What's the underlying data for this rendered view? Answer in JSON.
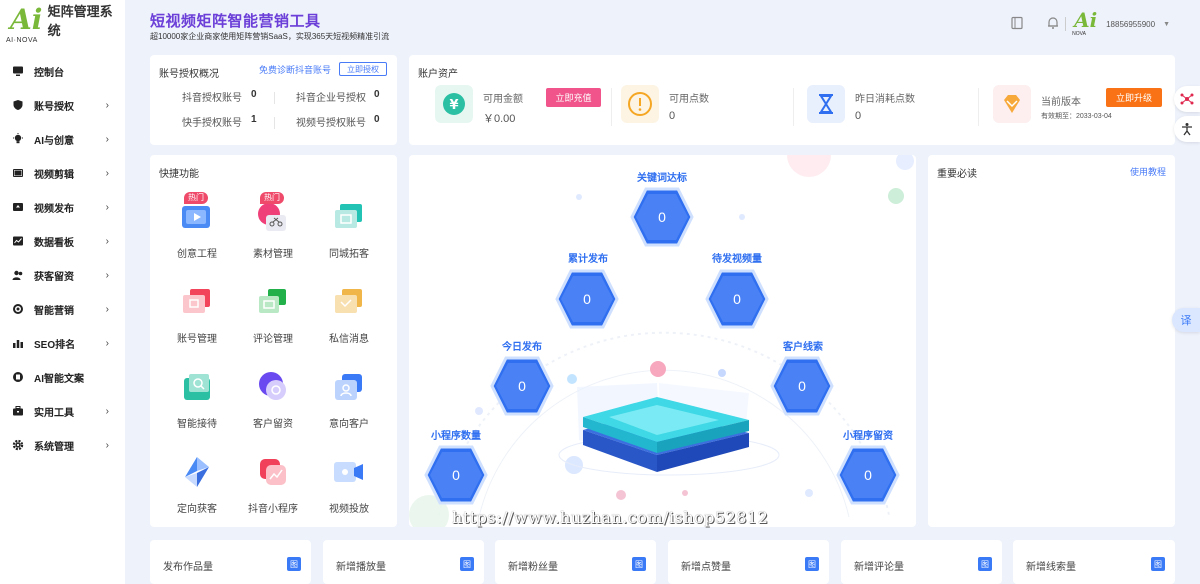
{
  "brand": {
    "logo_mark": "Ai",
    "logo_sub": "AI·NOVA",
    "title": "矩阵管理系统"
  },
  "sidebar": {
    "items": [
      {
        "label": "控制台",
        "icon": "monitor-icon",
        "chev": ""
      },
      {
        "label": "账号授权",
        "icon": "shield-icon",
        "chev": "›"
      },
      {
        "label": "AI与创意",
        "icon": "bulb-icon",
        "chev": "›"
      },
      {
        "label": "视频剪辑",
        "icon": "film-icon",
        "chev": "›"
      },
      {
        "label": "视频发布",
        "icon": "upload-icon",
        "chev": "›"
      },
      {
        "label": "数据看板",
        "icon": "chart-icon",
        "chev": "›"
      },
      {
        "label": "获客留资",
        "icon": "users-icon",
        "chev": "›"
      },
      {
        "label": "智能营销",
        "icon": "target-icon",
        "chev": "›"
      },
      {
        "label": "SEO排名",
        "icon": "bars-icon",
        "chev": "›"
      },
      {
        "label": "AI智能文案",
        "icon": "doc-icon",
        "chev": ""
      },
      {
        "label": "实用工具",
        "icon": "toolbox-icon",
        "chev": "›"
      },
      {
        "label": "系统管理",
        "icon": "gear-icon",
        "chev": "›"
      }
    ]
  },
  "header": {
    "title": "短视频矩阵智能营销工具",
    "subtitle": "超10000家企业商家使用矩阵营销SaaS，实现365天短视频精准引流",
    "phone": "18856955900",
    "caret": "▼",
    "avatar_mark": "Ai",
    "avatar_sub": "NOVA"
  },
  "accounts": {
    "title": "账号授权概况",
    "diag_link": "免费诊断抖音账号",
    "auth_button": "立即授权",
    "rows": [
      {
        "k1": "抖音授权账号",
        "v1": "0",
        "k2": "抖音企业号授权",
        "v2": "0"
      },
      {
        "k1": "快手授权账号",
        "v1": "1",
        "k2": "视频号授权账号",
        "v2": "0"
      }
    ]
  },
  "assets": {
    "title": "账户资产",
    "balance_label": "可用金额",
    "balance_value": "￥0.00",
    "recharge_button": "立即充值",
    "points_label": "可用点数",
    "points_value": "0",
    "consumed_label": "昨日消耗点数",
    "consumed_value": "0",
    "version_label": "当前版本",
    "version_expiry": "有效期至：2033-03-04",
    "upgrade_button": "立即升级",
    "colors": {
      "yen": "#2bbfa4",
      "warn": "#f5a623",
      "hourglass": "#2f6ff0",
      "upgrade": "#f97316",
      "recharge": "#f0548a"
    }
  },
  "quick": {
    "title": "快捷功能",
    "hot_badge": "热门",
    "items": [
      {
        "label": "创意工程",
        "icon": "video-icon",
        "hot": true
      },
      {
        "label": "素材管理",
        "icon": "scissors-icon",
        "hot": true
      },
      {
        "label": "同城拓客",
        "icon": "screen-icon",
        "hot": false
      },
      {
        "label": "账号管理",
        "icon": "account-card-icon",
        "hot": false
      },
      {
        "label": "评论管理",
        "icon": "comment-icon",
        "hot": false
      },
      {
        "label": "私信消息",
        "icon": "message-icon",
        "hot": false
      },
      {
        "label": "智能接待",
        "icon": "reception-icon",
        "hot": false
      },
      {
        "label": "客户留资",
        "icon": "lead-icon",
        "hot": false
      },
      {
        "label": "意向客户",
        "icon": "intent-icon",
        "hot": false
      },
      {
        "label": "定向获客",
        "icon": "target-acquire-icon",
        "hot": false
      },
      {
        "label": "抖音小程序",
        "icon": "miniapp-icon",
        "hot": false
      },
      {
        "label": "视频投放",
        "icon": "camera-icon",
        "hot": false
      }
    ]
  },
  "metrics": [
    {
      "label": "关键词达标",
      "value": "0"
    },
    {
      "label": "累计发布",
      "value": "0"
    },
    {
      "label": "待发视频量",
      "value": "0"
    },
    {
      "label": "今日发布",
      "value": "0"
    },
    {
      "label": "客户线索",
      "value": "0"
    },
    {
      "label": "小程序数量",
      "value": "0"
    },
    {
      "label": "小程序留资",
      "value": "0"
    }
  ],
  "notice": {
    "title": "重要必读",
    "link": "使用教程"
  },
  "bottom": [
    {
      "label": "发布作品量",
      "icon_glyph": "图"
    },
    {
      "label": "新增播放量",
      "icon_glyph": "图"
    },
    {
      "label": "新增粉丝量",
      "icon_glyph": "图"
    },
    {
      "label": "新增点赞量",
      "icon_glyph": "图"
    },
    {
      "label": "新增评论量",
      "icon_glyph": "图"
    },
    {
      "label": "新增线索量",
      "icon_glyph": "图"
    }
  ],
  "float": {
    "translate": "译"
  },
  "watermark": "https://www.huzhan.com/ishop52812"
}
